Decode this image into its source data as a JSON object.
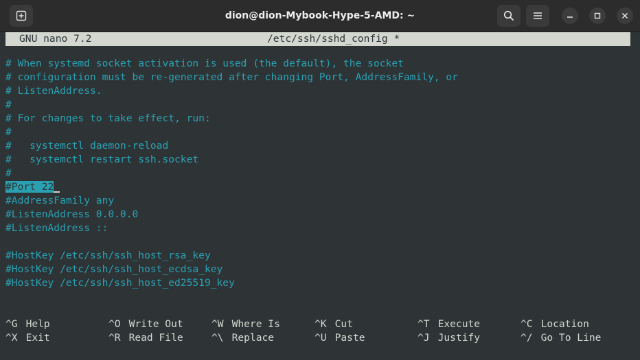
{
  "window": {
    "title": "dion@dion-Mybook-Hype-5-AMD: ~"
  },
  "nano": {
    "app": "GNU nano 7.2",
    "file": "/etc/ssh/sshd_config *"
  },
  "lines": [
    "# When systemd socket activation is used (the default), the socket",
    "# configuration must be re-generated after changing Port, AddressFamily, or",
    "# ListenAddress.",
    "#",
    "# For changes to take effect, run:",
    "#",
    "#   systemctl daemon-reload",
    "#   systemctl restart ssh.socket",
    "#",
    "#Port 22",
    "#AddressFamily any",
    "#ListenAddress 0.0.0.0",
    "#ListenAddress ::",
    "",
    "#HostKey /etc/ssh/ssh_host_rsa_key",
    "#HostKey /etc/ssh/ssh_host_ecdsa_key",
    "#HostKey /etc/ssh/ssh_host_ed25519_key"
  ],
  "shortcuts_row1": [
    {
      "key": "^G",
      "label": "Help"
    },
    {
      "key": "^O",
      "label": "Write Out"
    },
    {
      "key": "^W",
      "label": "Where Is"
    },
    {
      "key": "^K",
      "label": "Cut"
    },
    {
      "key": "^T",
      "label": "Execute"
    },
    {
      "key": "^C",
      "label": "Location"
    }
  ],
  "shortcuts_row2": [
    {
      "key": "^X",
      "label": "Exit"
    },
    {
      "key": "^R",
      "label": "Read File"
    },
    {
      "key": "^\\",
      "label": "Replace"
    },
    {
      "key": "^U",
      "label": "Paste"
    },
    {
      "key": "^J",
      "label": "Justify"
    },
    {
      "key": "^/",
      "label": "Go To Line"
    }
  ],
  "icons": {
    "new_tab": "new-tab-icon",
    "search": "search-icon",
    "menu": "hamburger-menu-icon",
    "minimize": "minimize-icon",
    "maximize": "maximize-icon",
    "close": "close-icon"
  }
}
